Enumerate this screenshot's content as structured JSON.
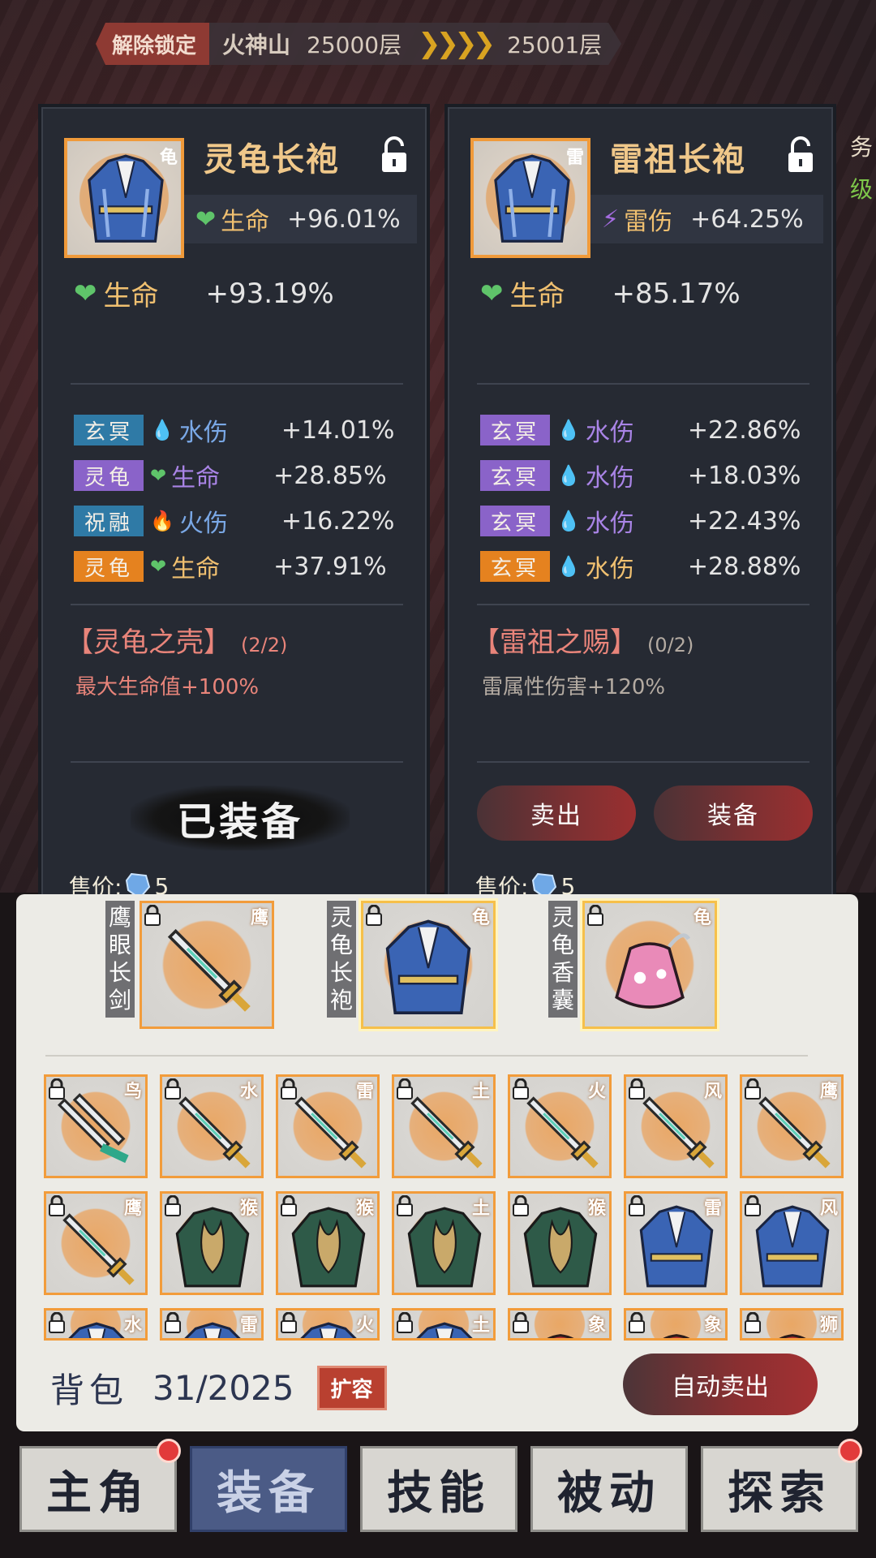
{
  "topbar": {
    "unlock_label": "解除锁定",
    "mountain": "火神山",
    "floor_current": "25000层",
    "floor_next": "25001层"
  },
  "side_fragments": {
    "top": "务",
    "bottom": "级"
  },
  "left_card": {
    "thumb_tag": "龟",
    "name": "灵龟长袍",
    "main_stat": {
      "label": "生命",
      "value": "+96.01%"
    },
    "base_stat": {
      "label": "生命",
      "value": "+93.19%"
    },
    "subs": [
      {
        "badge": "玄冥",
        "badge_color": "#2f7aa6",
        "stat": "水伤",
        "stat_color": "#7aa8e6",
        "icon": "water-drop-icon",
        "value": "+14.01%"
      },
      {
        "badge": "灵龟",
        "badge_color": "#8a63c9",
        "stat": "生命",
        "stat_color": "#a984e6",
        "icon": "heart-icon",
        "value": "+28.85%"
      },
      {
        "badge": "祝融",
        "badge_color": "#2f7aa6",
        "stat": "火伤",
        "stat_color": "#7aa8e6",
        "icon": "fire-icon",
        "value": "+16.22%"
      },
      {
        "badge": "灵龟",
        "badge_color": "#e5821f",
        "stat": "生命",
        "stat_color": "#f0c070",
        "icon": "heart-icon",
        "value": "+37.91%"
      }
    ],
    "set_name": "【灵龟之壳】",
    "set_count": "(2/2)",
    "set_desc": "最大生命值+100%",
    "status": "已装备",
    "price_label": "售价:",
    "price_value": "5"
  },
  "right_card": {
    "thumb_tag": "雷",
    "name": "雷祖长袍",
    "main_stat": {
      "label": "雷伤",
      "value": "+64.25%"
    },
    "base_stat": {
      "label": "生命",
      "value": "+85.17%"
    },
    "subs": [
      {
        "badge": "玄冥",
        "badge_color": "#8a63c9",
        "stat": "水伤",
        "stat_color": "#a984e6",
        "icon": "water-drop-icon",
        "value": "+22.86%"
      },
      {
        "badge": "玄冥",
        "badge_color": "#8a63c9",
        "stat": "水伤",
        "stat_color": "#a984e6",
        "icon": "water-drop-icon",
        "value": "+18.03%"
      },
      {
        "badge": "玄冥",
        "badge_color": "#8a63c9",
        "stat": "水伤",
        "stat_color": "#a984e6",
        "icon": "water-drop-icon",
        "value": "+22.43%"
      },
      {
        "badge": "玄冥",
        "badge_color": "#e5821f",
        "stat": "水伤",
        "stat_color": "#f0c070",
        "icon": "water-drop-icon",
        "value": "+28.88%"
      }
    ],
    "set_name": "【雷祖之赐】",
    "set_count": "(0/2)",
    "set_desc": "雷属性伤害+120%",
    "sell_label": "卖出",
    "equip_label": "装备",
    "price_label": "售价:",
    "price_value": "5"
  },
  "equipped": [
    {
      "label": "鹰眼长剑",
      "tag": "鹰",
      "icon": "sword-icon"
    },
    {
      "label": "灵龟长袍",
      "tag": "龟",
      "icon": "robe-icon"
    },
    {
      "label": "灵龟香囊",
      "tag": "龟",
      "icon": "pouch-icon"
    }
  ],
  "inventory": [
    [
      {
        "tag": "鸟",
        "icon": "twin-sword-icon"
      },
      {
        "tag": "水",
        "icon": "sword-icon"
      },
      {
        "tag": "雷",
        "icon": "sword-icon"
      },
      {
        "tag": "土",
        "icon": "sword-icon"
      },
      {
        "tag": "火",
        "icon": "sword-icon"
      },
      {
        "tag": "风",
        "icon": "sword-icon"
      },
      {
        "tag": "鹰",
        "icon": "sword-icon"
      }
    ],
    [
      {
        "tag": "鹰",
        "icon": "sword-icon"
      },
      {
        "tag": "猴",
        "icon": "armor-icon"
      },
      {
        "tag": "猴",
        "icon": "armor-icon"
      },
      {
        "tag": "土",
        "icon": "armor-icon"
      },
      {
        "tag": "猴",
        "icon": "armor-icon"
      },
      {
        "tag": "雷",
        "icon": "robe-icon"
      },
      {
        "tag": "风",
        "icon": "robe-icon"
      }
    ],
    [
      {
        "tag": "水",
        "icon": "robe-icon"
      },
      {
        "tag": "雷",
        "icon": "robe-icon"
      },
      {
        "tag": "火",
        "icon": "robe-icon"
      },
      {
        "tag": "土",
        "icon": "robe-icon"
      },
      {
        "tag": "象",
        "icon": "helmet-icon"
      },
      {
        "tag": "象",
        "icon": "helmet-icon"
      },
      {
        "tag": "狮",
        "icon": "helmet-icon"
      }
    ]
  ],
  "bag": {
    "label": "背包",
    "count": "31/2025",
    "expand_label": "扩容",
    "auto_sell_label": "自动卖出"
  },
  "nav": [
    {
      "label": "主角",
      "active": false,
      "badge": true
    },
    {
      "label": "装备",
      "active": true,
      "badge": false
    },
    {
      "label": "技能",
      "active": false,
      "badge": false
    },
    {
      "label": "被动",
      "active": false,
      "badge": false
    },
    {
      "label": "探索",
      "active": false,
      "badge": true
    }
  ]
}
